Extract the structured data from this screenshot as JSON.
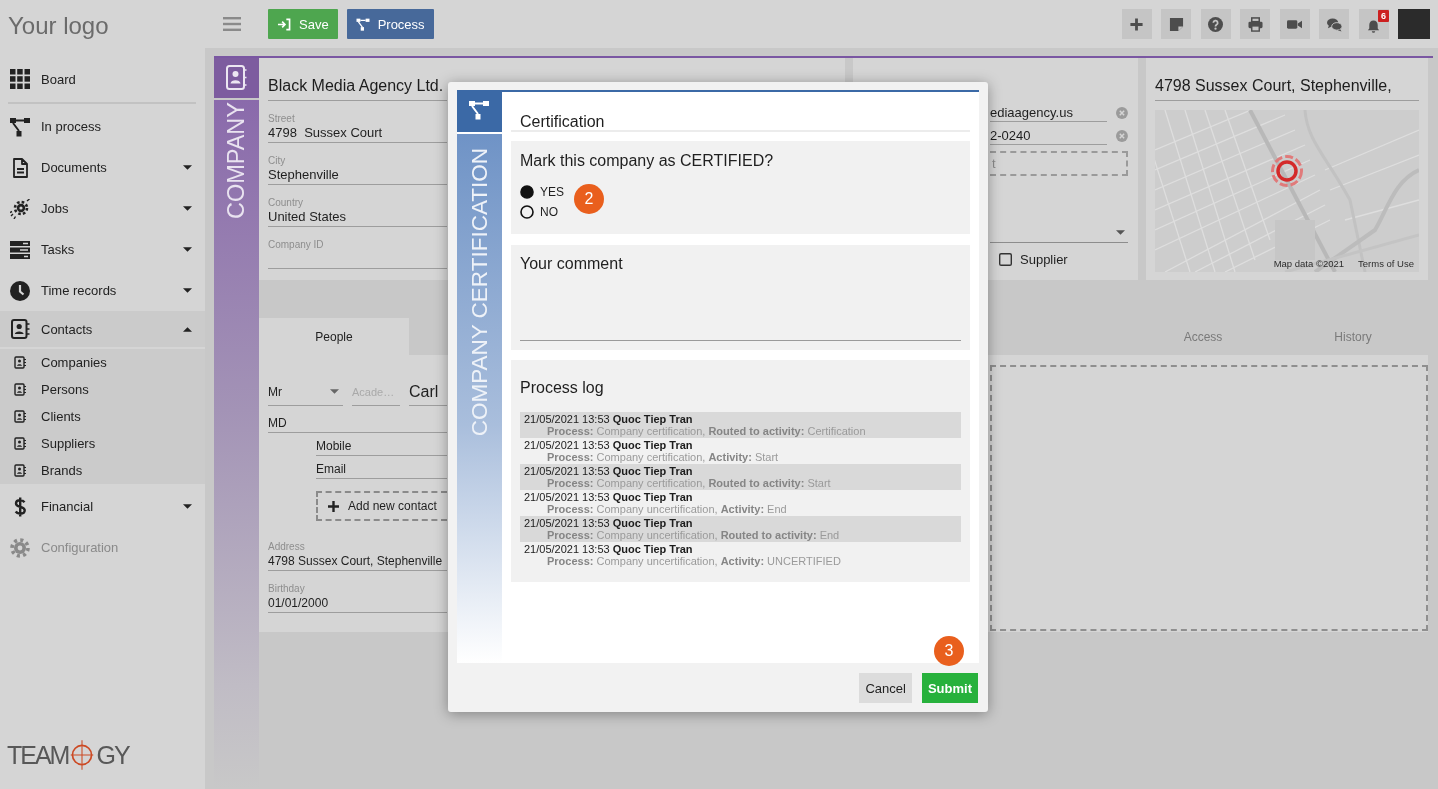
{
  "topbar": {
    "actions": [
      {
        "label": "Save",
        "kind": "save"
      },
      {
        "label": "Process",
        "kind": "process"
      }
    ],
    "notification_count": "6"
  },
  "sidebar": {
    "logo": "Your logo",
    "items": [
      {
        "label": "Board",
        "kind": "link",
        "disabled": false
      },
      {
        "label": "In process",
        "kind": "link",
        "disabled": false
      },
      {
        "label": "Documents",
        "kind": "group",
        "expanded": false,
        "disabled": false
      },
      {
        "label": "Jobs",
        "kind": "group",
        "expanded": false,
        "disabled": false
      },
      {
        "label": "Tasks",
        "kind": "group",
        "expanded": false,
        "disabled": false
      },
      {
        "label": "Time records",
        "kind": "group",
        "expanded": false,
        "disabled": false
      },
      {
        "label": "Contacts",
        "kind": "group",
        "expanded": true,
        "disabled": false,
        "children": [
          {
            "label": "Companies"
          },
          {
            "label": "Persons"
          },
          {
            "label": "Clients"
          },
          {
            "label": "Suppliers"
          },
          {
            "label": "Brands"
          }
        ]
      },
      {
        "label": "Financial",
        "kind": "group",
        "expanded": false,
        "disabled": false
      },
      {
        "label": "Configuration",
        "kind": "link",
        "disabled": true
      }
    ],
    "footer_logo": {
      "left": "TEAM",
      "right": "GY"
    }
  },
  "record": {
    "band_label": "COMPANY",
    "company": {
      "name": "Black Media Agency Ltd.",
      "fields": [
        {
          "label": "Street",
          "value": "4798  Sussex Court"
        },
        {
          "label": "City",
          "value": "Stephenville"
        },
        {
          "label": "Country",
          "value": "United States"
        },
        {
          "label": "Company ID"
        }
      ]
    },
    "contact": {
      "fields": [
        {
          "value": "ediaagency.us"
        },
        {
          "value": "2-0240"
        }
      ],
      "add_contact": "t",
      "supplier": {
        "label": "Supplier",
        "checked": false
      }
    },
    "address": {
      "title": "4798 Sussex Court, Stephenville,",
      "map_attribution": "Map data ©2021",
      "map_terms": "Terms of Use"
    },
    "tabs": [
      {
        "label": "People",
        "selected": true
      },
      {
        "label": "Access",
        "selected": false
      },
      {
        "label": "History",
        "selected": false
      }
    ],
    "person": {
      "salutation": "Mr",
      "academic_title_placeholder": "Acade…",
      "first_name": "Carl",
      "suffix": "MD",
      "contact_types": [
        "Mobile",
        "Email"
      ],
      "add_contact": "Add new contact",
      "fields": [
        {
          "label": "Address",
          "value": "4798 Sussex Court, Stephenville"
        },
        {
          "label": "Birthday",
          "value": "01/01/2000"
        }
      ]
    }
  },
  "modal": {
    "band_label": "COMPANY CERTIFICATION",
    "title": "Certification",
    "question": {
      "text": "Mark this company as CERTIFIED?",
      "options": [
        {
          "label": "YES",
          "selected": true
        },
        {
          "label": "NO",
          "selected": false
        }
      ],
      "callout": "2"
    },
    "comment_label": "Your comment",
    "log_title": "Process log",
    "log": [
      {
        "header": "21/05/2021 13:53 **Quoc Tiep Tran**",
        "detail": "**Process:** Company certification, **Routed to activity:** Certification"
      },
      {
        "header": "21/05/2021 13:53 **Quoc Tiep Tran**",
        "detail": "**Process:** Company certification, **Activity:** Start"
      },
      {
        "header": "21/05/2021 13:53 **Quoc Tiep Tran**",
        "detail": "**Process:** Company certification, **Routed to activity:** Start"
      },
      {
        "header": "21/05/2021 13:53 **Quoc Tiep Tran**",
        "detail": "**Process:** Company uncertification, **Activity:** End"
      },
      {
        "header": "21/05/2021 13:53 **Quoc Tiep Tran**",
        "detail": "**Process:** Company uncertification, **Routed to activity:** End"
      },
      {
        "header": "21/05/2021 13:53 **Quoc Tiep Tran**",
        "detail": "**Process:** Company uncertification, **Activity:** UNCERTIFIED"
      }
    ],
    "buttons": [
      {
        "label": "Cancel",
        "kind": "secondary"
      },
      {
        "label": "Submit",
        "kind": "primary",
        "callout": "3"
      }
    ]
  }
}
